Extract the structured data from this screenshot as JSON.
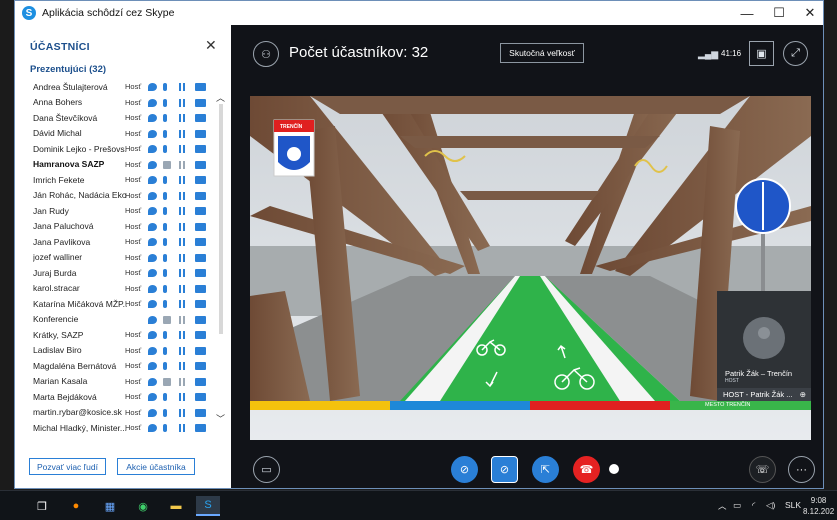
{
  "window": {
    "title": "Aplikácia schôdzí cez Skype",
    "controls": {
      "minimize": "—",
      "maximize": "☐",
      "close": "✕"
    }
  },
  "participants_panel": {
    "heading": "ÚČASTNÍCI",
    "group_label": "Prezentujúci (32)",
    "participants": [
      {
        "name": "Andrea Štulajterová",
        "role": "Hosť",
        "bold": false,
        "video": false
      },
      {
        "name": "Anna Bohers",
        "role": "Hosť",
        "bold": false,
        "video": false
      },
      {
        "name": "Dana Števčíková",
        "role": "Hosť",
        "bold": false,
        "video": false
      },
      {
        "name": "Dávid Michal",
        "role": "Hosť",
        "bold": false,
        "video": false
      },
      {
        "name": "Dominik Lejko - Prešovs...",
        "role": "Hosť",
        "bold": false,
        "video": false
      },
      {
        "name": "Hamranova SAZP",
        "role": "Hosť",
        "bold": true,
        "video": true
      },
      {
        "name": "Imrich Fekete",
        "role": "Hosť",
        "bold": false,
        "video": false
      },
      {
        "name": "Ján Rohác, Nadácia Eko...",
        "role": "Hosť",
        "bold": false,
        "video": false
      },
      {
        "name": "Jan Rudy",
        "role": "Hosť",
        "bold": false,
        "video": false
      },
      {
        "name": "Jana Paluchová",
        "role": "Hosť",
        "bold": false,
        "video": false
      },
      {
        "name": "Jana Pavlikova",
        "role": "Hosť",
        "bold": false,
        "video": false
      },
      {
        "name": "jozef walliner",
        "role": "Hosť",
        "bold": false,
        "video": false
      },
      {
        "name": "Juraj Burda",
        "role": "Hosť",
        "bold": false,
        "video": false
      },
      {
        "name": "karol.stracar",
        "role": "Hosť",
        "bold": false,
        "video": false
      },
      {
        "name": "Katarína Mičáková MŽP...",
        "role": "Hosť",
        "bold": false,
        "video": false
      },
      {
        "name": "Konferencie",
        "role": "",
        "bold": false,
        "video": true
      },
      {
        "name": "Krátky, SAZP",
        "role": "Hosť",
        "bold": false,
        "video": false
      },
      {
        "name": "Ladislav Biro",
        "role": "Hosť",
        "bold": false,
        "video": false
      },
      {
        "name": "Magdaléna Bernátová",
        "role": "Hosť",
        "bold": false,
        "video": false
      },
      {
        "name": "Marian Kasala",
        "role": "Hosť",
        "bold": false,
        "video": true
      },
      {
        "name": "Marta Bejdáková",
        "role": "Hosť",
        "bold": false,
        "video": false
      },
      {
        "name": "martin.rybar@kosice.sk",
        "role": "Hosť",
        "bold": false,
        "video": false
      },
      {
        "name": "Michal Hladký, Minister...",
        "role": "Hosť",
        "bold": false,
        "video": false
      }
    ],
    "invite_button": "Pozvať viac ľudí",
    "actions_button": "Akcie účastníka"
  },
  "stage": {
    "participant_count": "Počet účastníkov: 32",
    "real_size_button": "Skutočná veľkosť",
    "timer": "41:16",
    "pip_name": "Patrik Žák – Trenčín",
    "pip_role": "HOST",
    "pip_footer": "HOST - Patrik Žák ...",
    "crest_label": "TRENČÍN",
    "banner_text": "MESTO TRENČÍN",
    "banner_colors": [
      "#f4c20d",
      "#1e88d8",
      "#e02020",
      "#39b54a"
    ]
  },
  "taskbar": {
    "language": "SLK",
    "time": "9:08",
    "date": "8.12.202"
  }
}
